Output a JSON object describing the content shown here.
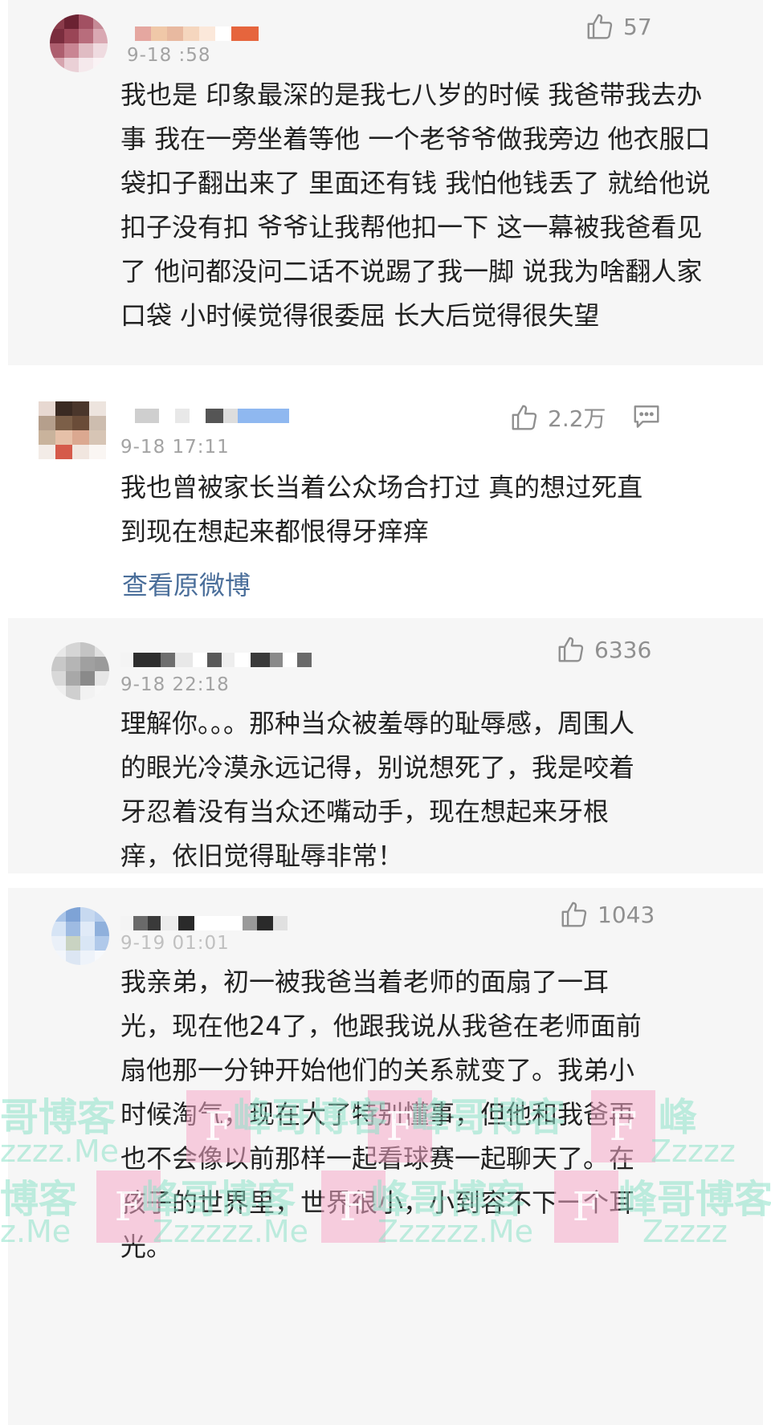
{
  "comments": [
    {
      "time": "9-18 :58",
      "likes": "57",
      "text": "我也是 印象最深的是我七八岁的时候 我爸带我去办事 我在一旁坐着等他 一个老爷爷做我旁边 他衣服口袋扣子翻出来了 里面还有钱 我怕他钱丢了 就给他说扣子没有扣 爷爷让我帮他扣一下 这一幕被我爸看见了 他问都没问二话不说踢了我一脚 说我为啥翻人家口袋 小时候觉得很委屈 长大后觉得很失望"
    },
    {
      "time": "9-18 17:11",
      "likes": "2.2万",
      "text": "我也曾被家长当着公众场合打过 真的想过死直到现在想起来都恨得牙痒痒",
      "link": "查看原微博"
    },
    {
      "time": "9-18 22:18",
      "likes": "6336",
      "text": "理解你。。。那种当众被羞辱的耻辱感，周围人的眼光冷漠永远记得，别说想死了，我是咬着牙忍着没有当众还嘴动手，现在想起来牙根痒，依旧觉得耻辱非常！"
    },
    {
      "time": "9-19 01:01",
      "likes": "1043",
      "text": "我亲弟，初一被我爸当着老师的面扇了一耳光，现在他24了，他跟我说从我爸在老师面前扇他那一分钟开始他们的关系就变了。我弟小时候淘气，现在大了特别懂事，但他和我爸再也不会像以前那样一起看球赛一起聊天了。在孩子的世界里，世界很小，小到容不下一个耳光。"
    }
  ],
  "watermark": {
    "brand": "峰哥博客",
    "brand_short_a": "哥博客",
    "brand_short_b": "博客",
    "brand_char": "峰",
    "url": "Zzzzzz.Me",
    "url_short_a": "zzzz.Me",
    "url_short_b": "z.Me",
    "url_short_c": "Zzzzz",
    "logo_letter": "F"
  },
  "icons": {
    "like": "thumbs-up-icon",
    "comment": "comment-bubble-icon"
  },
  "colors": {
    "card_bg": "#f6f6f6",
    "text": "#222222",
    "meta": "#a3a3a3",
    "link": "#4a6e9a",
    "watermark_text": "#8ce1c8",
    "watermark_box": "#f5aac8"
  }
}
